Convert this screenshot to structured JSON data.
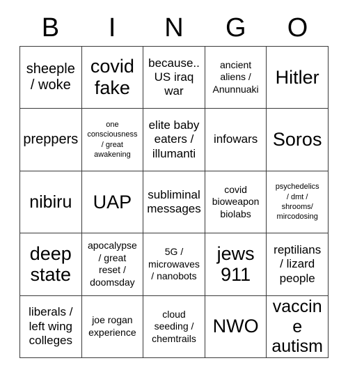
{
  "card": {
    "title": "BINGO",
    "header_letters": [
      "B",
      "I",
      "N",
      "G",
      "O"
    ],
    "colors": {
      "background": "#ffffff",
      "text": "#000000",
      "grid_line": "#3a3a3a"
    },
    "grid_size": "5x5",
    "cells": [
      {
        "text": "sheeple\n/ woke",
        "size": "lg",
        "row": 1,
        "col": 1
      },
      {
        "text": "covid\nfake",
        "size": "xxl",
        "row": 1,
        "col": 2
      },
      {
        "text": "because..\nUS iraq\nwar",
        "size": "md",
        "row": 1,
        "col": 3
      },
      {
        "text": "ancient\naliens /\nAnunnuaki",
        "size": "sm",
        "row": 1,
        "col": 4
      },
      {
        "text": "Hitler",
        "size": "xxl",
        "row": 1,
        "col": 5
      },
      {
        "text": "preppers",
        "size": "lg",
        "row": 2,
        "col": 1
      },
      {
        "text": "one\nconsciousness\n/ great\nawakening",
        "size": "xs",
        "row": 2,
        "col": 2
      },
      {
        "text": "elite baby\neaters /\nillumanti",
        "size": "md",
        "row": 2,
        "col": 3
      },
      {
        "text": "infowars",
        "size": "md",
        "row": 2,
        "col": 4
      },
      {
        "text": "Soros",
        "size": "xxl",
        "row": 2,
        "col": 5
      },
      {
        "text": "nibiru",
        "size": "xl",
        "row": 3,
        "col": 1
      },
      {
        "text": "UAP",
        "size": "xxl",
        "row": 3,
        "col": 2
      },
      {
        "text": "subliminal\nmessages",
        "size": "md",
        "row": 3,
        "col": 3
      },
      {
        "text": "covid\nbioweapon\nbiolabs",
        "size": "sm",
        "row": 3,
        "col": 4
      },
      {
        "text": "psychedelics\n/ dmt /\nshrooms/\nmircodosing",
        "size": "xs",
        "row": 3,
        "col": 5
      },
      {
        "text": "deep\nstate",
        "size": "xxl",
        "row": 4,
        "col": 1
      },
      {
        "text": "apocalypse\n/ great\nreset /\ndoomsday",
        "size": "sm",
        "row": 4,
        "col": 2
      },
      {
        "text": "5G /\nmicrowaves\n/ nanobots",
        "size": "sm",
        "row": 4,
        "col": 3
      },
      {
        "text": "jews\n911",
        "size": "xxl",
        "row": 4,
        "col": 4
      },
      {
        "text": "reptilians\n/ lizard\npeople",
        "size": "md",
        "row": 4,
        "col": 5
      },
      {
        "text": "liberals /\nleft wing\ncolleges",
        "size": "md",
        "row": 5,
        "col": 1
      },
      {
        "text": "joe rogan\nexperience",
        "size": "sm",
        "row": 5,
        "col": 2
      },
      {
        "text": "cloud\nseeding /\nchemtrails",
        "size": "sm",
        "row": 5,
        "col": 3
      },
      {
        "text": "NWO",
        "size": "xxl",
        "row": 5,
        "col": 4
      },
      {
        "text": "vaccine\nautism",
        "size": "xl",
        "row": 5,
        "col": 5
      }
    ]
  }
}
